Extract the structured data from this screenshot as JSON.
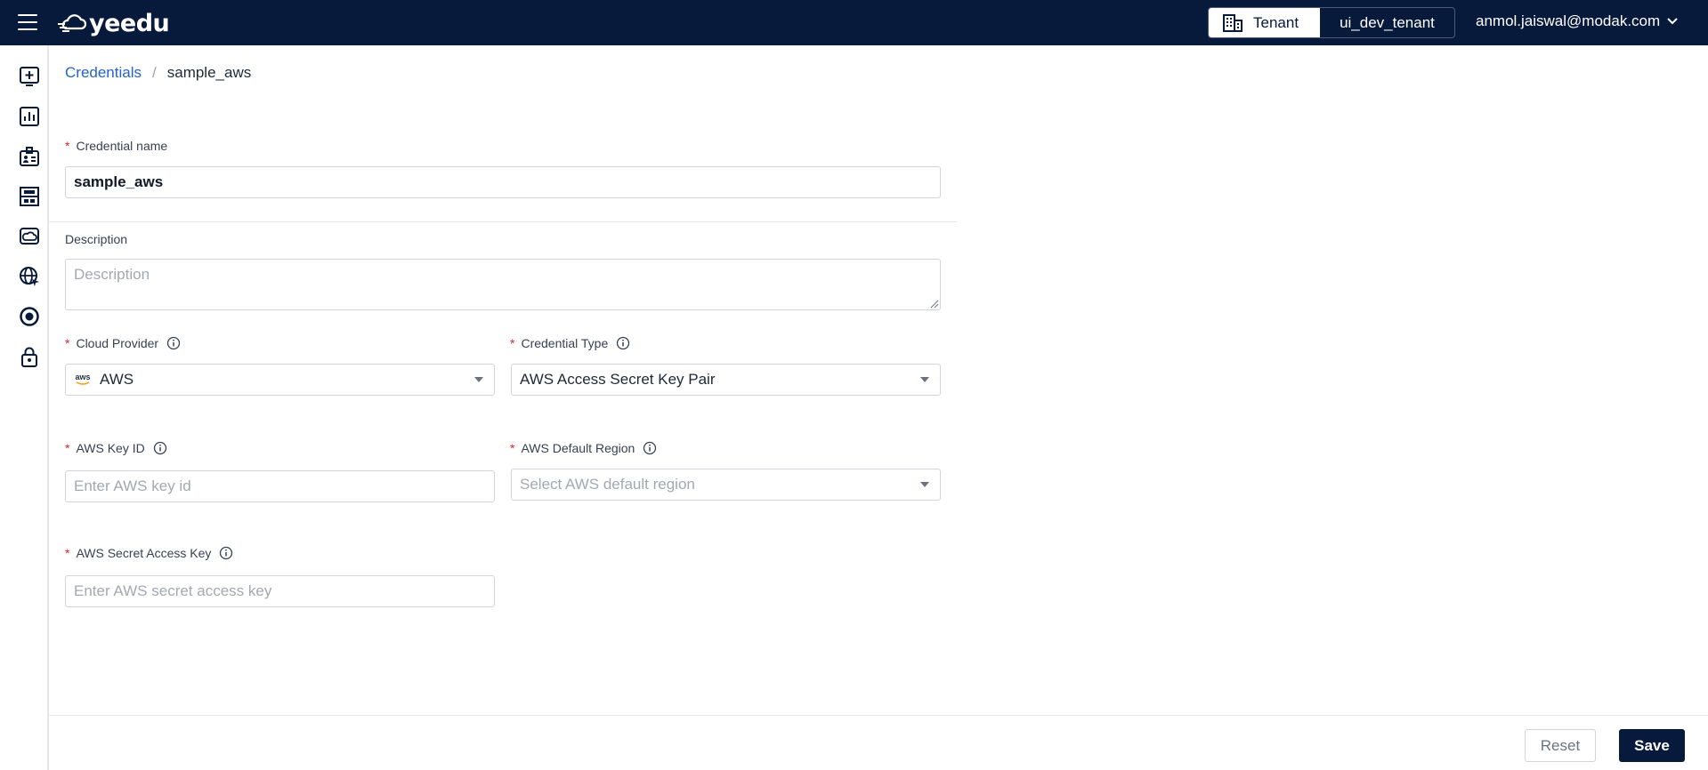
{
  "header": {
    "logo_text": "yeedu",
    "tenant_label": "Tenant",
    "tenant_name": "ui_dev_tenant",
    "user_email": "anmol.jaiswal@modak.com"
  },
  "sidebar": {
    "items": [
      {
        "icon": "add-screen-icon"
      },
      {
        "icon": "chart-icon"
      },
      {
        "icon": "id-badge-icon"
      },
      {
        "icon": "workspace-icon"
      },
      {
        "icon": "cloud-screen-icon"
      },
      {
        "icon": "globe-icon"
      },
      {
        "icon": "target-icon"
      },
      {
        "icon": "lock-icon"
      }
    ]
  },
  "breadcrumb": {
    "parent": "Credentials",
    "separator": "/",
    "current": "sample_aws"
  },
  "form": {
    "required_mark": "*",
    "credential_name": {
      "label": "Credential name",
      "value": "sample_aws"
    },
    "description": {
      "label": "Description",
      "placeholder": "Description"
    },
    "cloud_provider": {
      "label": "Cloud Provider",
      "value": "AWS",
      "badge_text": "aws"
    },
    "credential_type": {
      "label": "Credential Type",
      "value": "AWS Access Secret Key Pair"
    },
    "aws_key_id": {
      "label": "AWS Key ID",
      "placeholder": "Enter AWS key id"
    },
    "aws_default_region": {
      "label": "AWS Default Region",
      "placeholder": "Select AWS default region"
    },
    "aws_secret_access_key": {
      "label": "AWS Secret Access Key",
      "placeholder": "Enter AWS secret access key"
    }
  },
  "footer": {
    "reset_label": "Reset",
    "save_label": "Save"
  },
  "colors": {
    "topbar": "#071a3b",
    "link": "#2563c9",
    "required": "#dc2626"
  }
}
